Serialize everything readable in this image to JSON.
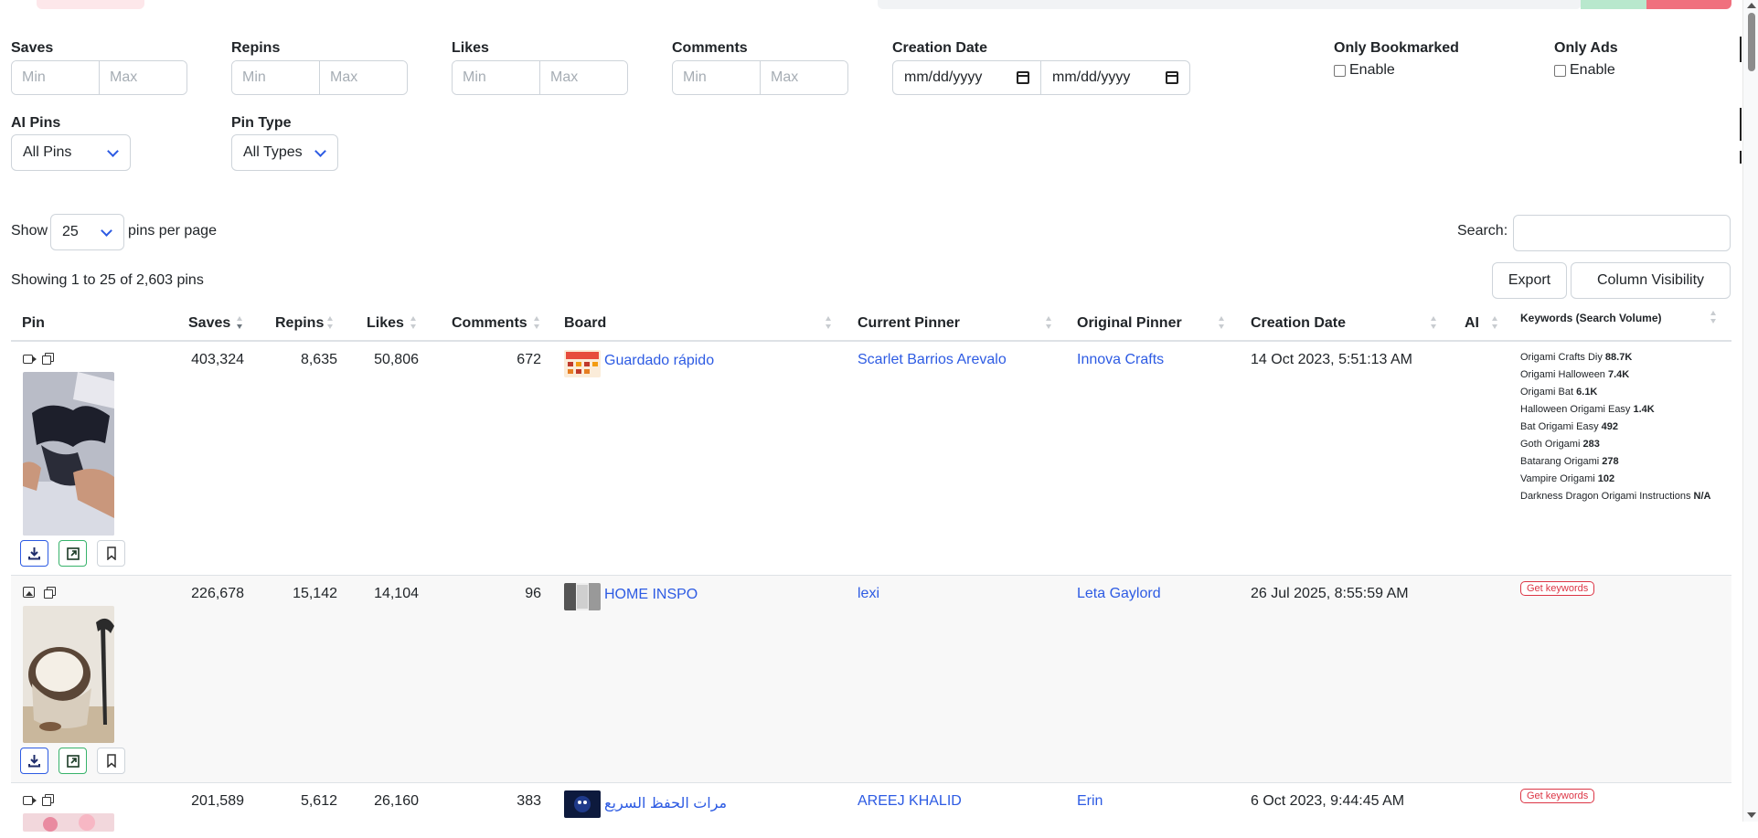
{
  "filters": {
    "saves": {
      "label": "Saves",
      "min_placeholder": "Min",
      "max_placeholder": "Max"
    },
    "repins": {
      "label": "Repins",
      "min_placeholder": "Min",
      "max_placeholder": "Max"
    },
    "likes": {
      "label": "Likes",
      "min_placeholder": "Min",
      "max_placeholder": "Max"
    },
    "comments": {
      "label": "Comments",
      "min_placeholder": "Min",
      "max_placeholder": "Max"
    },
    "creation_date": {
      "label": "Creation Date",
      "from_placeholder": "mm/dd/yyyy",
      "to_placeholder": "mm/dd/yyyy"
    },
    "only_bookmarked": {
      "label": "Only Bookmarked",
      "checkbox_label": "Enable",
      "checked": false
    },
    "only_ads": {
      "label": "Only Ads",
      "checkbox_label": "Enable",
      "checked": false
    },
    "ai_pins": {
      "label": "AI Pins",
      "selected": "All Pins"
    },
    "pin_type": {
      "label": "Pin Type",
      "selected": "All Types"
    }
  },
  "controls": {
    "show_label": "Show",
    "page_size": "25",
    "per_page_label": "pins per page",
    "search_label": "Search:",
    "search_value": "",
    "info": "Showing 1 to 25 of 2,603 pins",
    "export_label": "Export",
    "column_visibility_label": "Column Visibility"
  },
  "table": {
    "headers": {
      "pin": "Pin",
      "saves": "Saves",
      "repins": "Repins",
      "likes": "Likes",
      "comments": "Comments",
      "board": "Board",
      "current_pinner": "Current Pinner",
      "original_pinner": "Original Pinner",
      "creation_date": "Creation Date",
      "ai": "AI",
      "keywords": "Keywords (Search Volume)"
    },
    "sorted_column": "saves",
    "sort_direction": "desc",
    "rows": [
      {
        "media_type_icon": "video-icon",
        "saves": "403,324",
        "repins": "8,635",
        "likes": "50,806",
        "comments": "672",
        "board": "Guardado rápido",
        "current_pinner": "Scarlet Barrios Arevalo",
        "original_pinner": "Innova Crafts",
        "creation_date": "14 Oct 2023, 5:51:13 AM",
        "keywords": [
          {
            "term": "Origami Crafts Diy",
            "volume": "88.7K"
          },
          {
            "term": "Origami Halloween",
            "volume": "7.4K"
          },
          {
            "term": "Origami Bat",
            "volume": "6.1K"
          },
          {
            "term": "Halloween Origami Easy",
            "volume": "1.4K"
          },
          {
            "term": "Bat Origami Easy",
            "volume": "492"
          },
          {
            "term": "Goth Origami",
            "volume": "283"
          },
          {
            "term": "Batarang Origami",
            "volume": "278"
          },
          {
            "term": "Vampire Origami",
            "volume": "102"
          },
          {
            "term": "Darkness Dragon Origami Instructions",
            "volume": "N/A"
          }
        ]
      },
      {
        "media_type_icon": "image-icon",
        "saves": "226,678",
        "repins": "15,142",
        "likes": "14,104",
        "comments": "96",
        "board": "HOME INSPO",
        "current_pinner": "lexi",
        "original_pinner": "Leta Gaylord",
        "creation_date": "26 Jul 2025, 8:55:59 AM",
        "get_keywords_label": "Get keywords"
      },
      {
        "media_type_icon": "video-icon",
        "saves": "201,589",
        "repins": "5,612",
        "likes": "26,160",
        "comments": "383",
        "board": "مرات الحفظ السريع",
        "current_pinner": "AREEJ KHALID",
        "original_pinner": "Erin",
        "creation_date": "6 Oct 2023, 9:44:45 AM",
        "get_keywords_label": "Get keywords"
      }
    ]
  },
  "colors": {
    "link": "#2d5be3",
    "danger": "#dc3545",
    "success": "#37b36b",
    "border": "#ced4da"
  }
}
